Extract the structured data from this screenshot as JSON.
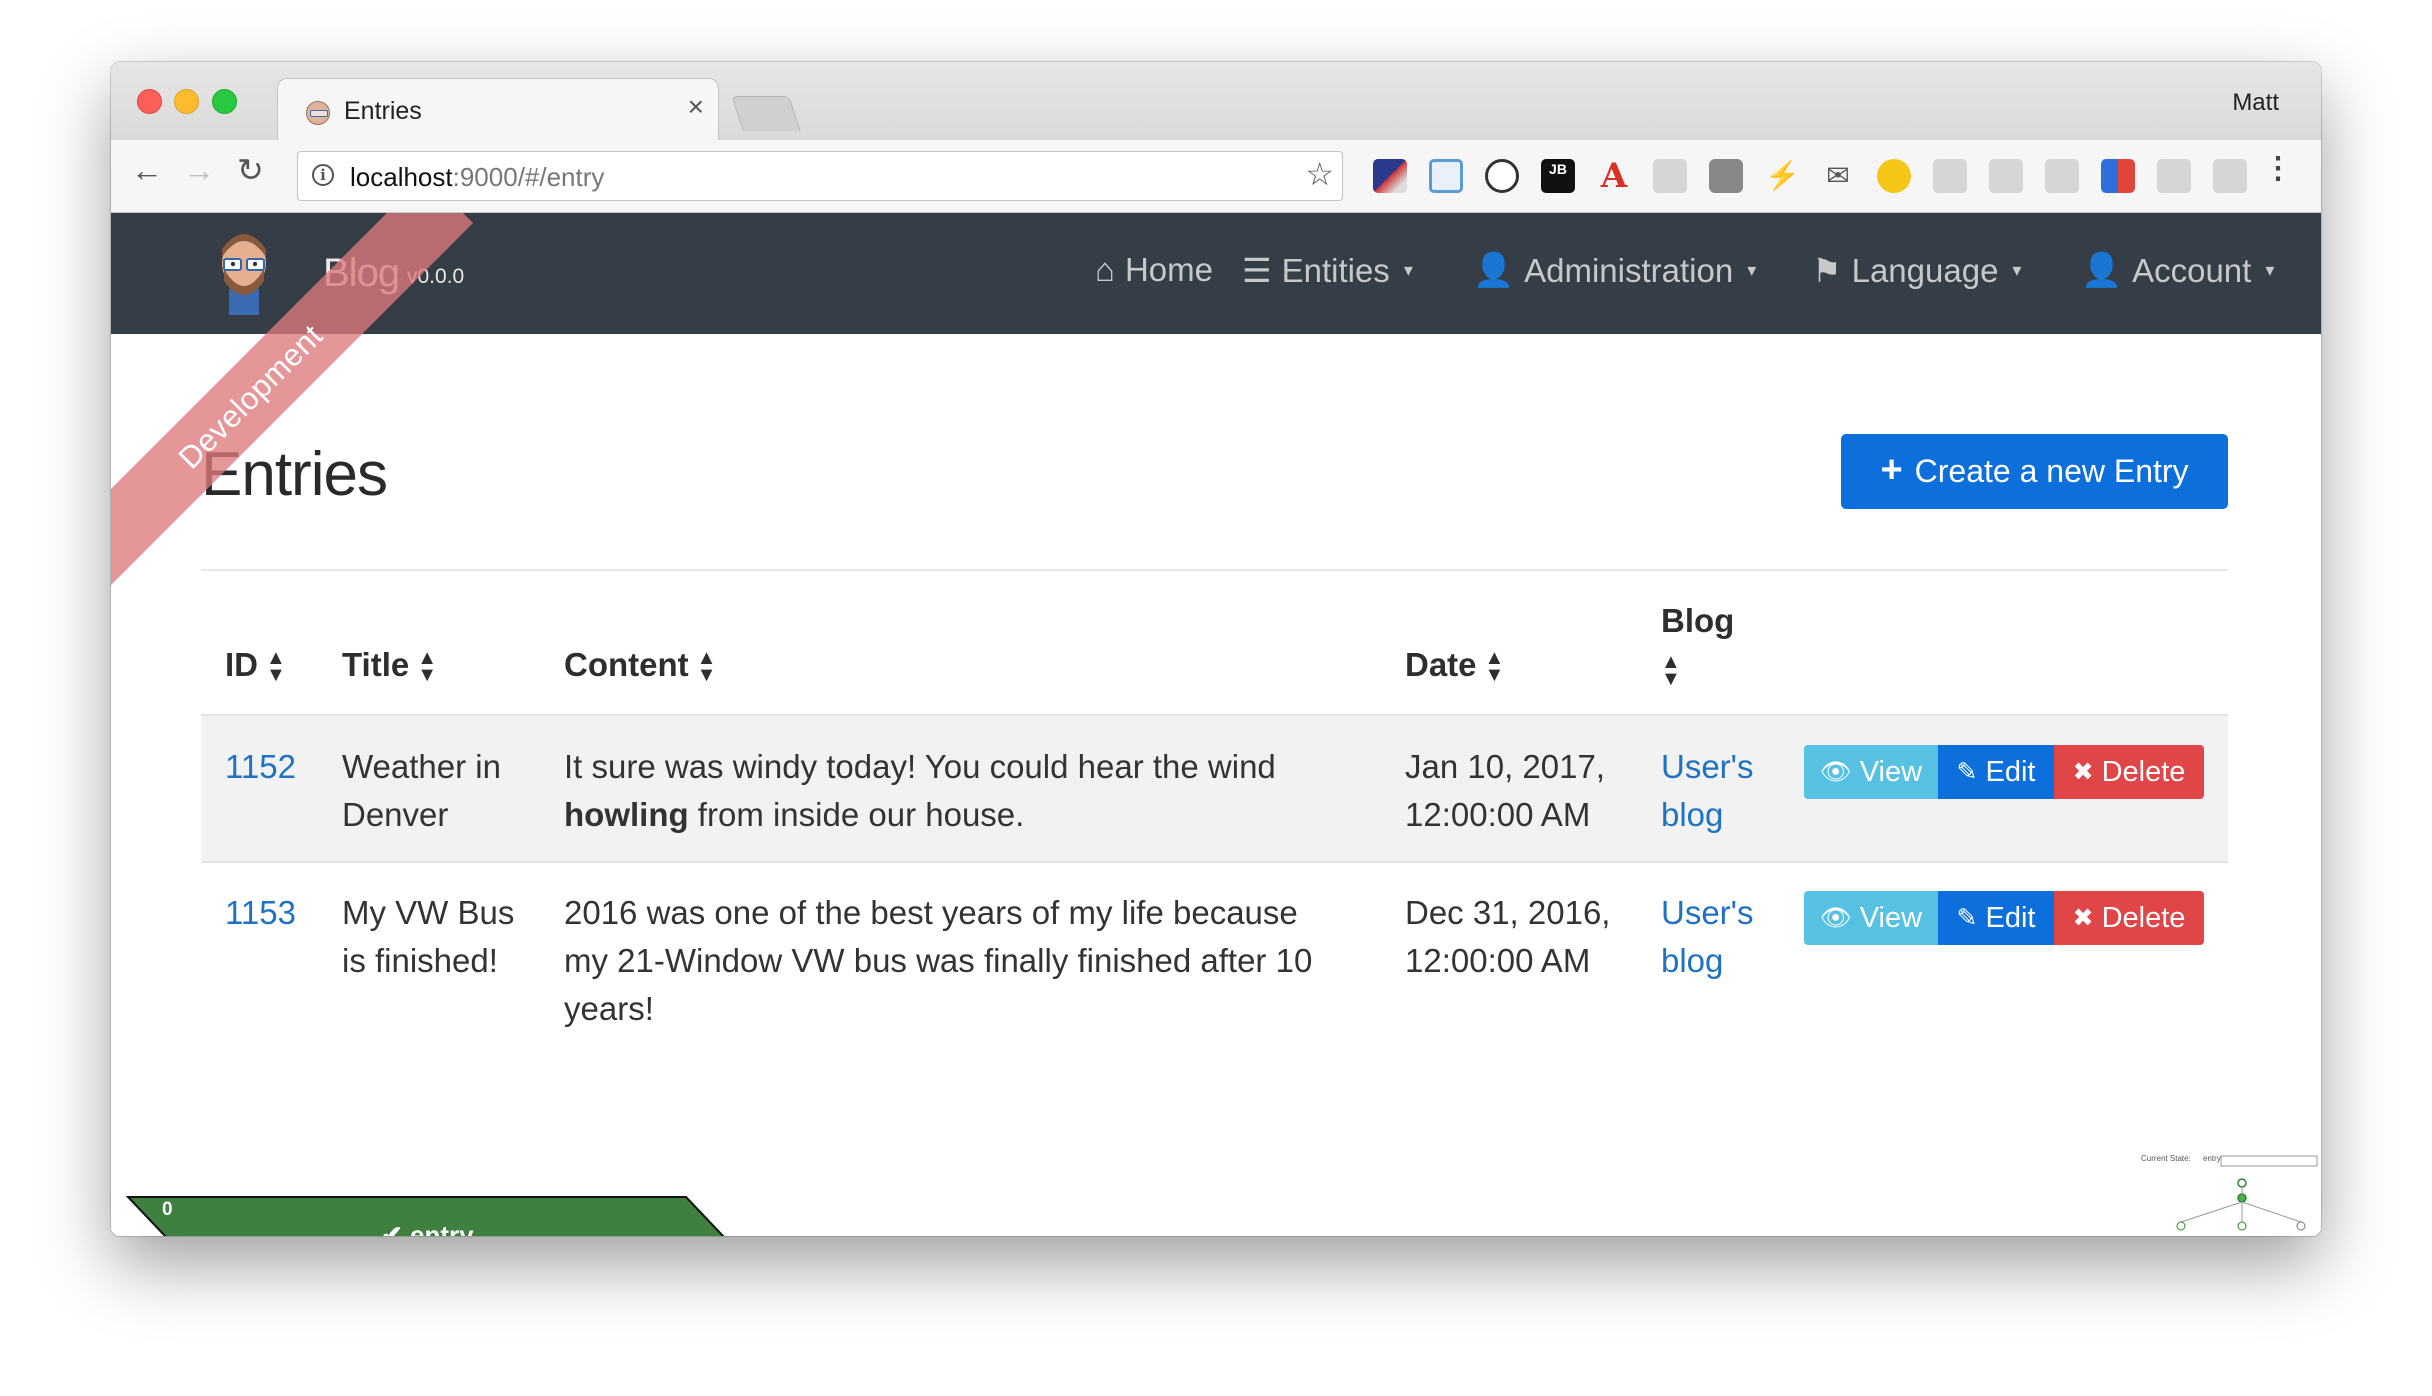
{
  "browser": {
    "tab_title": "Entries",
    "tab_close": "×",
    "profile_name": "Matt",
    "url_host": "localhost",
    "url_rest": ":9000/#/entry",
    "back": "←",
    "forward": "→",
    "reload": "↻",
    "bookmark": "☆",
    "menu": "⋮",
    "extensions": [
      "sketch-icon",
      "window-icon",
      "1password-icon",
      "jetbrains-icon",
      "acrobat-icon",
      "react-icon",
      "shield-icon",
      "bolt-icon",
      "mail-icon",
      "moon-icon",
      "translate-icon",
      "users-icon",
      "reader-icon",
      "bookmark-flag-icon",
      "help-icon",
      "wc-icon"
    ]
  },
  "navbar": {
    "brand": "Blog",
    "version": "v0.0.0",
    "ribbon": "Development",
    "items": [
      {
        "icon": "⌂",
        "label": "Home"
      },
      {
        "icon": "☰",
        "label": "Entities",
        "caret": "▾"
      },
      {
        "icon": "👤",
        "label": "Administration",
        "caret": "▾"
      },
      {
        "icon": "⚑",
        "label": "Language",
        "caret": "▾"
      },
      {
        "icon": "👤",
        "label": "Account",
        "caret": "▾"
      }
    ]
  },
  "page": {
    "title": "Entries",
    "create_button": "Create a new Entry",
    "create_icon": "+"
  },
  "table": {
    "headers": {
      "id": "ID",
      "title": "Title",
      "content": "Content",
      "date": "Date",
      "blog": "Blog"
    },
    "sort_icon": "▲▼",
    "rows": [
      {
        "id": "1152",
        "title_line1": "Weather in",
        "title_line2": "Denver",
        "content_line1": "It sure was windy today! You could hear the wind",
        "content_bold": "howling",
        "content_line2_rest": " from inside our house.",
        "date_line1": "Jan 10, 2017,",
        "date_line2": "12:00:00 AM",
        "blog_line1": "User's",
        "blog_line2": "blog"
      },
      {
        "id": "1153",
        "title_line1": "My VW Bus",
        "title_line2": "is finished!",
        "content_line1": "2016 was one of the best years of my life because",
        "content_line2": "my 21-Window VW bus was finally finished after 10",
        "content_line3": "years!",
        "date_line1": "Dec 31, 2016,",
        "date_line2": "12:00:00 AM",
        "blog_line1": "User's",
        "blog_line2": "blog"
      }
    ],
    "actions": {
      "view": "View",
      "edit": "Edit",
      "delete": "Delete",
      "view_icon": "👁",
      "edit_icon": "✎",
      "delete_icon": "✖"
    }
  },
  "status": {
    "count": "0",
    "label": "success",
    "state": "✔ entry",
    "color": "#3f7f3f"
  },
  "state_visualizer": {
    "label": "Current State:",
    "value": "entry"
  }
}
